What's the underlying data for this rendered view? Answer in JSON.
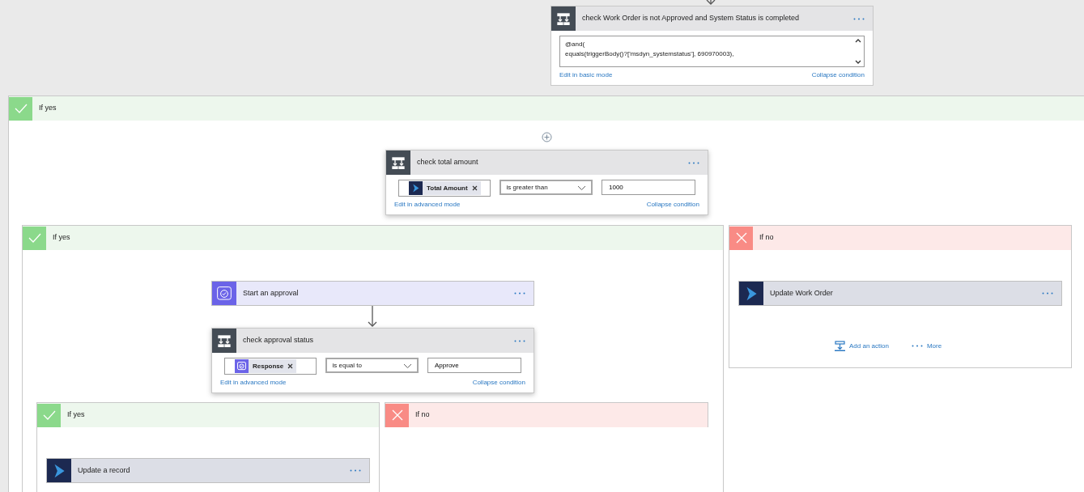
{
  "conditions": [
    {
      "title": "check Work Order is not Approved and System Status is completed",
      "kind": "advanced",
      "expression_lines": [
        "@and(",
        "equals(triggerBody()?['msdyn_systemstatus'], 690970003),"
      ],
      "mode_link": "Edit in basic mode",
      "collapse_link": "Collapse condition"
    },
    {
      "title": "check total amount",
      "kind": "basic",
      "token": {
        "label": "Total Amount",
        "kind": "dynamics"
      },
      "operator": "is greater than",
      "value": "1000",
      "mode_link": "Edit in advanced mode",
      "collapse_link": "Collapse condition"
    },
    {
      "title": "check approval status",
      "kind": "basic",
      "token": {
        "label": "Response",
        "kind": "approval"
      },
      "operator": "is equal to",
      "value": "Approve",
      "mode_link": "Edit in advanced mode",
      "collapse_link": "Collapse condition"
    }
  ],
  "branches": [
    {
      "label": "If yes",
      "kind": "yes"
    },
    {
      "label": "If yes",
      "kind": "yes"
    },
    {
      "label": "If no",
      "kind": "no"
    },
    {
      "label": "If yes",
      "kind": "yes"
    },
    {
      "label": "If no",
      "kind": "no"
    }
  ],
  "actions": [
    {
      "title": "Start an approval",
      "kind": "approval"
    },
    {
      "title": "Update Work Order",
      "kind": "dynamics"
    },
    {
      "title": "Update a record",
      "kind": "dynamics"
    }
  ],
  "branch_footer": {
    "add_action": "Add an action",
    "more": "More"
  }
}
